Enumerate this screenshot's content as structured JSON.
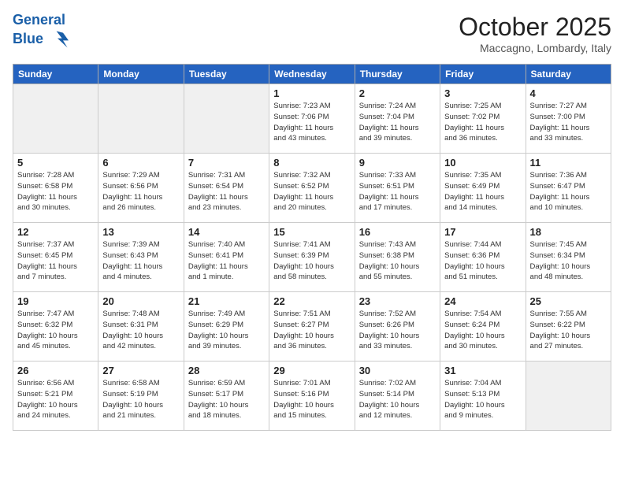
{
  "header": {
    "logo_line1": "General",
    "logo_line2": "Blue",
    "month": "October 2025",
    "location": "Maccagno, Lombardy, Italy"
  },
  "weekdays": [
    "Sunday",
    "Monday",
    "Tuesday",
    "Wednesday",
    "Thursday",
    "Friday",
    "Saturday"
  ],
  "weeks": [
    [
      {
        "day": "",
        "info": "",
        "empty": true
      },
      {
        "day": "",
        "info": "",
        "empty": true
      },
      {
        "day": "",
        "info": "",
        "empty": true
      },
      {
        "day": "1",
        "info": "Sunrise: 7:23 AM\nSunset: 7:06 PM\nDaylight: 11 hours\nand 43 minutes.",
        "empty": false
      },
      {
        "day": "2",
        "info": "Sunrise: 7:24 AM\nSunset: 7:04 PM\nDaylight: 11 hours\nand 39 minutes.",
        "empty": false
      },
      {
        "day": "3",
        "info": "Sunrise: 7:25 AM\nSunset: 7:02 PM\nDaylight: 11 hours\nand 36 minutes.",
        "empty": false
      },
      {
        "day": "4",
        "info": "Sunrise: 7:27 AM\nSunset: 7:00 PM\nDaylight: 11 hours\nand 33 minutes.",
        "empty": false
      }
    ],
    [
      {
        "day": "5",
        "info": "Sunrise: 7:28 AM\nSunset: 6:58 PM\nDaylight: 11 hours\nand 30 minutes.",
        "empty": false
      },
      {
        "day": "6",
        "info": "Sunrise: 7:29 AM\nSunset: 6:56 PM\nDaylight: 11 hours\nand 26 minutes.",
        "empty": false
      },
      {
        "day": "7",
        "info": "Sunrise: 7:31 AM\nSunset: 6:54 PM\nDaylight: 11 hours\nand 23 minutes.",
        "empty": false
      },
      {
        "day": "8",
        "info": "Sunrise: 7:32 AM\nSunset: 6:52 PM\nDaylight: 11 hours\nand 20 minutes.",
        "empty": false
      },
      {
        "day": "9",
        "info": "Sunrise: 7:33 AM\nSunset: 6:51 PM\nDaylight: 11 hours\nand 17 minutes.",
        "empty": false
      },
      {
        "day": "10",
        "info": "Sunrise: 7:35 AM\nSunset: 6:49 PM\nDaylight: 11 hours\nand 14 minutes.",
        "empty": false
      },
      {
        "day": "11",
        "info": "Sunrise: 7:36 AM\nSunset: 6:47 PM\nDaylight: 11 hours\nand 10 minutes.",
        "empty": false
      }
    ],
    [
      {
        "day": "12",
        "info": "Sunrise: 7:37 AM\nSunset: 6:45 PM\nDaylight: 11 hours\nand 7 minutes.",
        "empty": false
      },
      {
        "day": "13",
        "info": "Sunrise: 7:39 AM\nSunset: 6:43 PM\nDaylight: 11 hours\nand 4 minutes.",
        "empty": false
      },
      {
        "day": "14",
        "info": "Sunrise: 7:40 AM\nSunset: 6:41 PM\nDaylight: 11 hours\nand 1 minute.",
        "empty": false
      },
      {
        "day": "15",
        "info": "Sunrise: 7:41 AM\nSunset: 6:39 PM\nDaylight: 10 hours\nand 58 minutes.",
        "empty": false
      },
      {
        "day": "16",
        "info": "Sunrise: 7:43 AM\nSunset: 6:38 PM\nDaylight: 10 hours\nand 55 minutes.",
        "empty": false
      },
      {
        "day": "17",
        "info": "Sunrise: 7:44 AM\nSunset: 6:36 PM\nDaylight: 10 hours\nand 51 minutes.",
        "empty": false
      },
      {
        "day": "18",
        "info": "Sunrise: 7:45 AM\nSunset: 6:34 PM\nDaylight: 10 hours\nand 48 minutes.",
        "empty": false
      }
    ],
    [
      {
        "day": "19",
        "info": "Sunrise: 7:47 AM\nSunset: 6:32 PM\nDaylight: 10 hours\nand 45 minutes.",
        "empty": false
      },
      {
        "day": "20",
        "info": "Sunrise: 7:48 AM\nSunset: 6:31 PM\nDaylight: 10 hours\nand 42 minutes.",
        "empty": false
      },
      {
        "day": "21",
        "info": "Sunrise: 7:49 AM\nSunset: 6:29 PM\nDaylight: 10 hours\nand 39 minutes.",
        "empty": false
      },
      {
        "day": "22",
        "info": "Sunrise: 7:51 AM\nSunset: 6:27 PM\nDaylight: 10 hours\nand 36 minutes.",
        "empty": false
      },
      {
        "day": "23",
        "info": "Sunrise: 7:52 AM\nSunset: 6:26 PM\nDaylight: 10 hours\nand 33 minutes.",
        "empty": false
      },
      {
        "day": "24",
        "info": "Sunrise: 7:54 AM\nSunset: 6:24 PM\nDaylight: 10 hours\nand 30 minutes.",
        "empty": false
      },
      {
        "day": "25",
        "info": "Sunrise: 7:55 AM\nSunset: 6:22 PM\nDaylight: 10 hours\nand 27 minutes.",
        "empty": false
      }
    ],
    [
      {
        "day": "26",
        "info": "Sunrise: 6:56 AM\nSunset: 5:21 PM\nDaylight: 10 hours\nand 24 minutes.",
        "empty": false
      },
      {
        "day": "27",
        "info": "Sunrise: 6:58 AM\nSunset: 5:19 PM\nDaylight: 10 hours\nand 21 minutes.",
        "empty": false
      },
      {
        "day": "28",
        "info": "Sunrise: 6:59 AM\nSunset: 5:17 PM\nDaylight: 10 hours\nand 18 minutes.",
        "empty": false
      },
      {
        "day": "29",
        "info": "Sunrise: 7:01 AM\nSunset: 5:16 PM\nDaylight: 10 hours\nand 15 minutes.",
        "empty": false
      },
      {
        "day": "30",
        "info": "Sunrise: 7:02 AM\nSunset: 5:14 PM\nDaylight: 10 hours\nand 12 minutes.",
        "empty": false
      },
      {
        "day": "31",
        "info": "Sunrise: 7:04 AM\nSunset: 5:13 PM\nDaylight: 10 hours\nand 9 minutes.",
        "empty": false
      },
      {
        "day": "",
        "info": "",
        "empty": true
      }
    ]
  ]
}
